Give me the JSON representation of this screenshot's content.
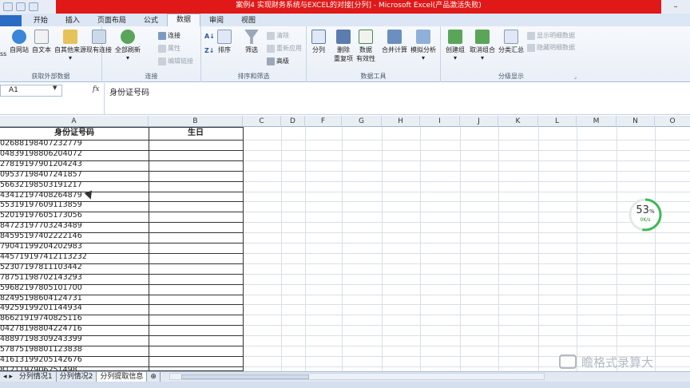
{
  "titlebar": {
    "title": "案例4 实现财务系统与EXCEL的对接[分列] - Microsoft Excel(产品激活失败)"
  },
  "tabs": [
    "开始",
    "插入",
    "页面布局",
    "公式",
    "数据",
    "审阅",
    "视图"
  ],
  "active_tab": "数据",
  "ribbon": {
    "groups": {
      "external": {
        "name": "获取外部数据",
        "buttons": [
          "自网站",
          "自文本",
          "自其他来源",
          "现有连接"
        ],
        "cut_label": "ss"
      },
      "connections": {
        "name": "连接",
        "refresh": "全部刷新",
        "items": [
          "连接",
          "属性",
          "编辑链接"
        ]
      },
      "sort": {
        "name": "排序和筛选",
        "sort": "排序",
        "filter": "筛选",
        "items": [
          "清除",
          "重新应用",
          "高级"
        ]
      },
      "tools": {
        "name": "数据工具",
        "buttons": [
          "分列",
          "删除\n重复项",
          "数据\n有效性",
          "合并计算",
          "模拟分析"
        ]
      },
      "outline": {
        "name": "分级显示",
        "buttons": [
          "创建组",
          "取消组合",
          "分类汇总"
        ],
        "items": [
          "显示明细数据",
          "隐藏明细数据"
        ]
      }
    }
  },
  "formula_bar": {
    "cell_ref": "A1",
    "fx": "fx",
    "content": "身份证号码"
  },
  "columns": [
    "A",
    "B",
    "C",
    "D",
    "F",
    "G",
    "H",
    "I",
    "J",
    "K",
    "L",
    "M",
    "N",
    "O"
  ],
  "headers": {
    "a": "身份证号码",
    "b": "生日"
  },
  "rows": [
    "0268819840723277​9",
    "0483919880620407​2",
    "2781919790120424​3",
    "0953719840724185​7",
    "5663219850319121​7",
    "4341219740826487​9",
    "5531919760911385​9",
    "5201919760517305​6",
    "8472319770324348​9",
    "8459519740222214​6",
    "7904119920420298​3",
    "4457191974121132​32",
    "5230719781110344​2",
    "7875119870214329​3",
    "5968219780510170​0",
    "8249519860412473​1",
    "4925919920114493​4",
    "8662191974082511​6",
    "0427819880422471​6",
    "4889719830924339​9",
    "5787519880112383​8",
    "4161319920514267​6",
    "8121197906251498"
  ],
  "sheet_tabs": [
    "分列情况1",
    "分列情况2",
    "分列提取信息"
  ],
  "active_sheet": "分列提取信息",
  "gauge": {
    "percent": "53",
    "unit": "%",
    "rate": "0K/s"
  },
  "watermark": "瞻格式录算大",
  "colors": {
    "title_red": "#e01818",
    "file_tab": "#2a6cc4"
  }
}
